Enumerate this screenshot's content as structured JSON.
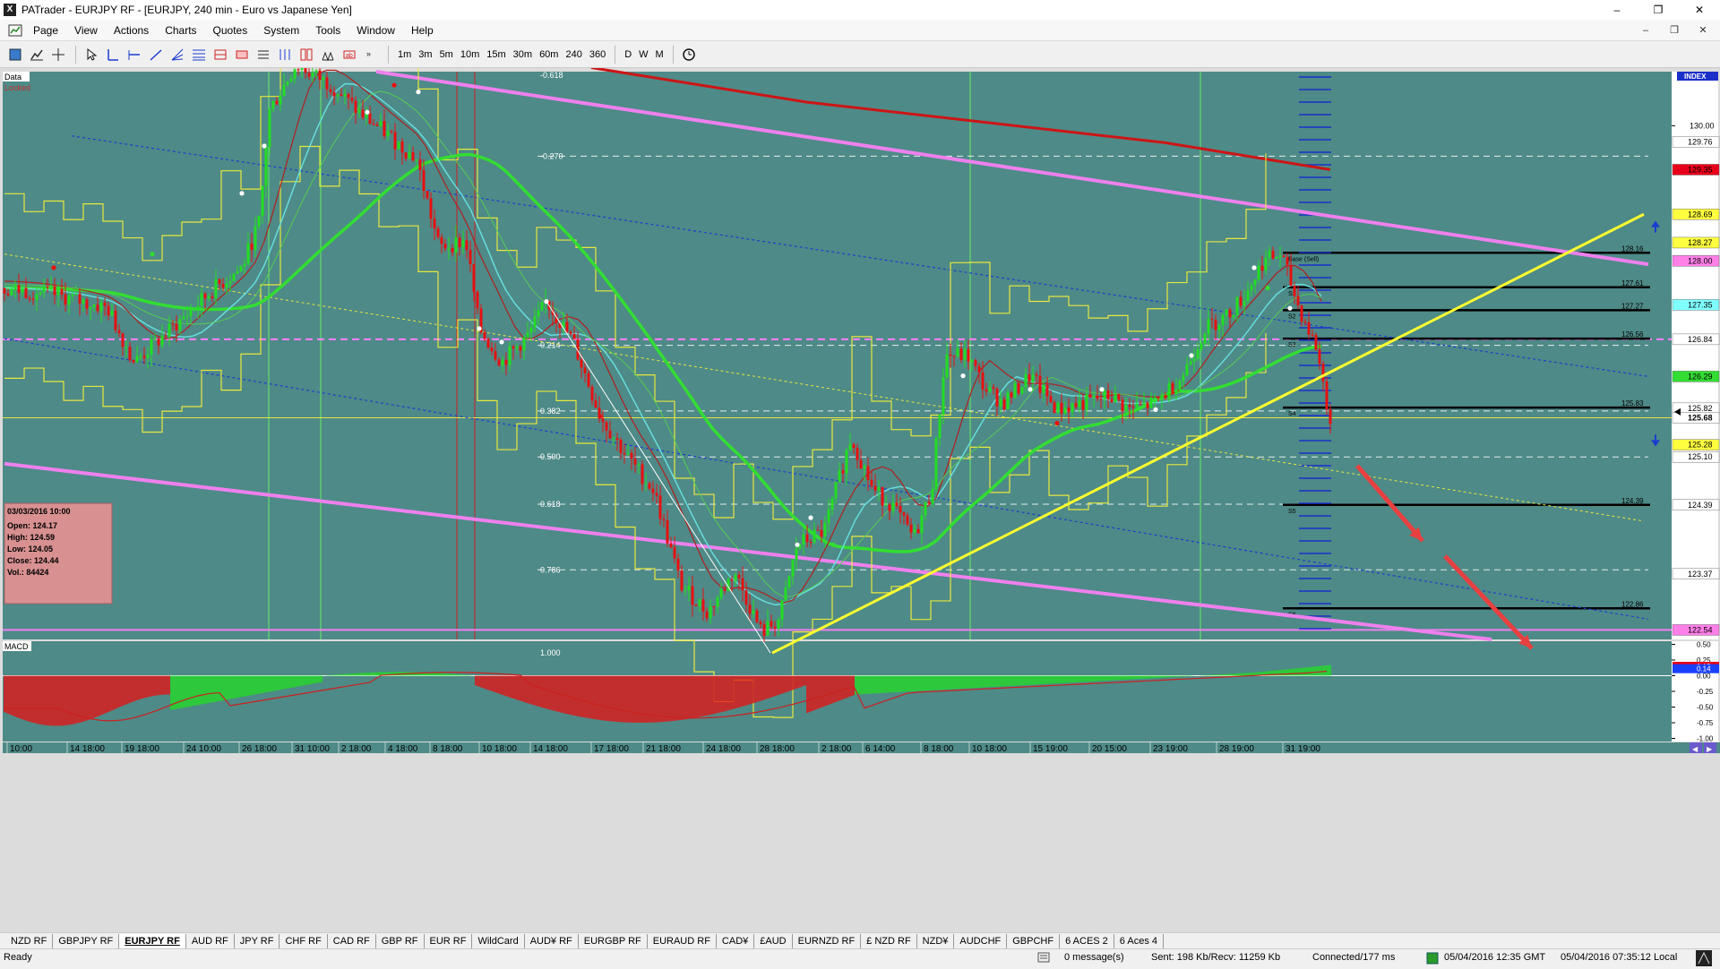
{
  "window": {
    "app_icon": "X",
    "title": "PATrader - EURJPY RF - [EURJPY, 240 min - Euro vs Japanese Yen]",
    "controls": [
      "–",
      "❐",
      "✕"
    ],
    "mdi_controls": [
      "–",
      "❐",
      "✕"
    ]
  },
  "menu": [
    "Page",
    "View",
    "Actions",
    "Charts",
    "Quotes",
    "System",
    "Tools",
    "Window",
    "Help"
  ],
  "toolbar": {
    "timeframes": [
      "1m",
      "3m",
      "5m",
      "10m",
      "15m",
      "30m",
      "60m",
      "240",
      "360"
    ],
    "periods": [
      "D",
      "W",
      "M"
    ],
    "tool_icons": [
      "book-icon",
      "chart-icon",
      "crosshair-icon",
      "cursor-icon",
      "line-tool-icon",
      "hline-tool-icon",
      "trendline-tool-icon",
      "fan-tool-icon",
      "fib-tool-icon",
      "channel-tool-icon",
      "rect-tool-icon",
      "text-tool-icon",
      "pitchfork-tool-icon",
      "gann-tool-icon",
      "cycle-tool-icon",
      "arrow-tool-icon",
      "more-icon"
    ],
    "clock_icon": "clock-icon"
  },
  "chart_data": {
    "type": "line",
    "title": "",
    "symbol": "EURJPY",
    "timeframe": "240 min",
    "labels": {
      "data": "Data",
      "locked": "Locked",
      "index": "INDEX",
      "macd": "MACD"
    },
    "x_tick_labels": [
      "10:00",
      "14 18:00",
      "19 18:00",
      "24 10:00",
      "26 18:00",
      "31 10:00",
      "2 18:00",
      "4 18:00",
      "8 18:00",
      "10 18:00",
      "14 18:00",
      "17 18:00",
      "21 18:00",
      "24 18:00",
      "28 18:00",
      "2 18:00",
      "6 14:00",
      "8 18:00",
      "10 18:00",
      "15 19:00",
      "20 15:00",
      "23 19:00",
      "28 19:00",
      "31 19:00"
    ],
    "y_axis": {
      "range": [
        122.4,
        130.8
      ],
      "ticks": [
        "130.00"
      ],
      "price_tags": [
        {
          "value": "129.76",
          "color": "#ffffff"
        },
        {
          "value": "129.35",
          "color": "#e8001a"
        },
        {
          "value": "128.69",
          "color": "#ffff40"
        },
        {
          "value": "128.27",
          "color": "#ffff40"
        },
        {
          "value": "128.00",
          "color": "#ff80e8"
        },
        {
          "value": "127.35",
          "color": "#80ffff"
        },
        {
          "value": "126.84",
          "color": "#ffffff"
        },
        {
          "value": "126.29",
          "color": "#33dd33"
        },
        {
          "value": "125.82",
          "color": "#ffffff"
        },
        {
          "value": "125.68",
          "color": "#ffffff"
        },
        {
          "value": "125.28",
          "color": "#ffff40"
        },
        {
          "value": "125.10",
          "color": "#ffffff"
        },
        {
          "value": "124.39",
          "color": "#ffffff"
        },
        {
          "value": "123.37",
          "color": "#ffffff"
        },
        {
          "value": "122.54",
          "color": "#ff80e8"
        }
      ],
      "current_price": "125.68"
    },
    "fib_levels": [
      {
        "ratio": "-0.618",
        "value": 131.03
      },
      {
        "ratio": "-0.270",
        "value": 129.55
      },
      {
        "ratio": "0.214",
        "value": 126.75
      },
      {
        "ratio": "0.382",
        "value": 125.78
      },
      {
        "ratio": "0.500",
        "value": 125.1
      },
      {
        "ratio": "0.618",
        "value": 124.4
      },
      {
        "ratio": "0.786",
        "value": 123.43
      },
      {
        "ratio": "1.000",
        "value": 122.2
      }
    ],
    "pivot_levels": [
      {
        "label": "128.16",
        "tag": "Base (Sell)",
        "value": 128.12
      },
      {
        "label": "127.61",
        "tag": "S1",
        "value": 127.61
      },
      {
        "label": "127.27",
        "tag": "S2",
        "value": 127.27
      },
      {
        "label": "126.56",
        "tag": "S3",
        "value": 126.85
      },
      {
        "label": "125.83",
        "tag": "S4",
        "value": 125.83
      },
      {
        "label": "124.39",
        "tag": "S5",
        "value": 124.39
      },
      {
        "label": "122.86",
        "tag": "S6",
        "value": 122.86
      }
    ],
    "info_box": {
      "date": "03/03/2016 10:00",
      "rows": [
        "Open: 124.17",
        "High: 124.59",
        "Low: 124.05",
        "Close: 124.44",
        "Vol.: 84424"
      ]
    },
    "macd_axis_ticks": [
      "0.50",
      "0.25",
      "0.00",
      "-0.25",
      "-0.50",
      "-0.75",
      "-1.00"
    ],
    "macd_tags": [
      {
        "value": "0.15",
        "color": "#e8001a"
      },
      {
        "value": "0.14",
        "color": "#1a40ff"
      }
    ],
    "colors": {
      "background": "#4e8a87",
      "bull": "#22dd22",
      "bear": "#e81010",
      "envelope": "#e8e840",
      "trendline_yellow": "#ffff30",
      "channel_magenta": "#ee80ee",
      "ma_red_dark": "#cc1515",
      "ma_green": "#33dd33",
      "ma_cyan": "#66dddd",
      "channel_blue": "#1f3ecf",
      "projection_arrow": "#e84040"
    },
    "grid": false
  },
  "symbol_tabs": [
    {
      "label": "NZD RF",
      "active": false
    },
    {
      "label": "GBPJPY RF",
      "active": false
    },
    {
      "label": "EURJPY RF",
      "active": true
    },
    {
      "label": "AUD RF",
      "active": false
    },
    {
      "label": "JPY RF",
      "active": false
    },
    {
      "label": "CHF RF",
      "active": false
    },
    {
      "label": "CAD RF",
      "active": false
    },
    {
      "label": "GBP RF",
      "active": false
    },
    {
      "label": "EUR RF",
      "active": false
    },
    {
      "label": "WildCard",
      "active": false
    },
    {
      "label": "AUD¥ RF",
      "active": false
    },
    {
      "label": "EURGBP RF",
      "active": false
    },
    {
      "label": "EURAUD RF",
      "active": false
    },
    {
      "label": "CAD¥",
      "active": false
    },
    {
      "label": "£AUD",
      "active": false
    },
    {
      "label": "EURNZD RF",
      "active": false
    },
    {
      "label": "£ NZD RF",
      "active": false
    },
    {
      "label": "NZD¥",
      "active": false
    },
    {
      "label": "AUDCHF",
      "active": false
    },
    {
      "label": "GBPCHF",
      "active": false
    },
    {
      "label": "6 ACES 2",
      "active": false
    },
    {
      "label": "6 Aces 4",
      "active": false
    }
  ],
  "status": {
    "ready": "Ready",
    "messages": "0 message(s)",
    "traffic": "Sent: 198 Kb/Recv: 11259 Kb",
    "connection": "Connected/177 ms",
    "gmt_time": "05/04/2016 12:35 GMT",
    "local_time": "05/04/2016 07:35:12 Local"
  }
}
